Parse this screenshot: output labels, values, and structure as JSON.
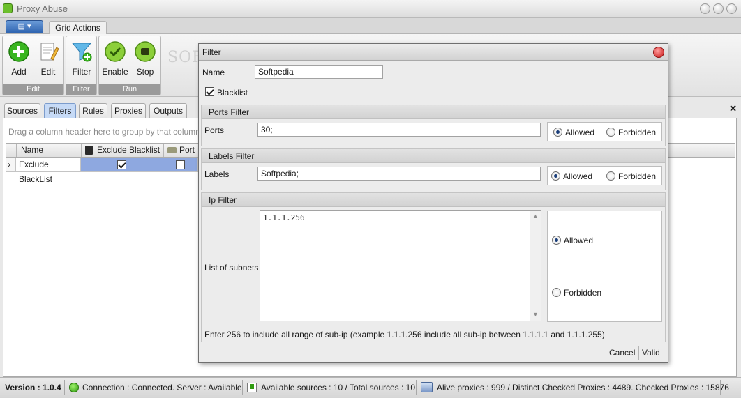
{
  "app": {
    "title": "Proxy Abuse"
  },
  "ribbon": {
    "tab": "Grid Actions",
    "groups": [
      {
        "label": "Edit",
        "buttons": [
          {
            "label": "Add",
            "icon": "plus-circle-icon"
          },
          {
            "label": "Edit",
            "icon": "edit-document-icon"
          }
        ]
      },
      {
        "label": "Filter",
        "buttons": [
          {
            "label": "Filter",
            "icon": "funnel-add-icon"
          }
        ]
      },
      {
        "label": "Run",
        "buttons": [
          {
            "label": "Enable",
            "icon": "check-circle-icon"
          },
          {
            "label": "Stop",
            "icon": "stop-circle-icon"
          }
        ]
      }
    ],
    "watermark": "SOFTPEDIA"
  },
  "tabs": [
    "Sources",
    "Filters",
    "Rules",
    "Proxies",
    "Outputs"
  ],
  "active_tab": "Filters",
  "grid": {
    "group_hint": "Drag a column header here to group by that column",
    "columns": [
      "Name",
      "Exclude Blacklist",
      "Port Fi"
    ],
    "rows": [
      {
        "name": "Exclude BlackList",
        "exclude_blacklist": true,
        "port_filter": false
      }
    ]
  },
  "dialog": {
    "title": "Filter",
    "name_label": "Name",
    "name_value": "Softpedia",
    "blacklist_label": "Blacklist",
    "blacklist_checked": true,
    "ports": {
      "header": "Ports Filter",
      "label": "Ports",
      "value": "30;",
      "allowed": "Allowed",
      "forbidden": "Forbidden",
      "selected": "Allowed"
    },
    "labels": {
      "header": "Labels Filter",
      "label": "Labels",
      "value": "Softpedia;",
      "allowed": "Allowed",
      "forbidden": "Forbidden",
      "selected": "Allowed"
    },
    "ip": {
      "header": "Ip Filter",
      "label": "List of subnets",
      "value": "1.1.1.256",
      "allowed": "Allowed",
      "forbidden": "Forbidden",
      "selected": "Allowed",
      "hint": "Enter 256 to include all range of sub-ip (example 1.1.1.256 include all sub-ip between 1.1.1.1 and 1.1.1.255)"
    },
    "cancel": "Cancel",
    "valid": "Valid"
  },
  "status": {
    "version": "Version : 1.0.4",
    "connection": "Connection : Connected. Server : Available",
    "sources": "Available sources : 10 / Total sources : 10.",
    "proxies": "Alive proxies : 999 / Distinct Checked Proxies : 4489. Checked Proxies : 15876"
  }
}
